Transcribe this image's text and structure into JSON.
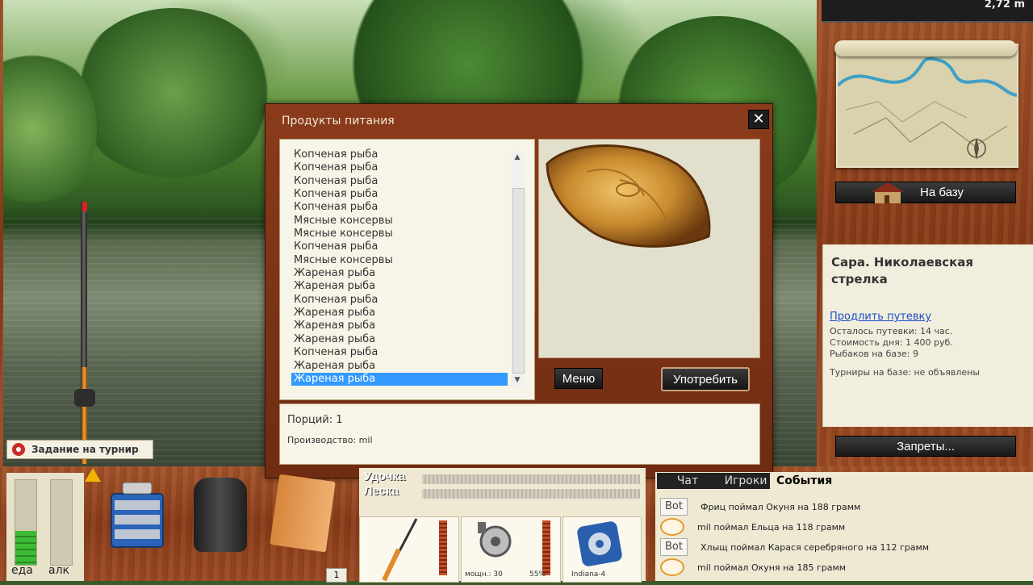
{
  "top_readout": {
    "depth": "2,72 m"
  },
  "right_panel": {
    "to_base_button": "На базу",
    "location": "Сара. Николаевская стрелка",
    "extend_link": "Продлить путевку",
    "info": [
      "Осталось путевки: 14 час.",
      "Стоимость дня: 1 400 руб.",
      "Рыбаков на базе: 9",
      "Турниры на базе: не объявлены"
    ],
    "bans_button": "Запреты..."
  },
  "dialog": {
    "title": "Продукты питания",
    "close_icon": "close-icon",
    "items": [
      "Копченая рыба",
      "Копченая рыба",
      "Копченая рыба",
      "Копченая рыба",
      "Копченая рыба",
      "Мясные консервы",
      "Мясные консервы",
      "Копченая рыба",
      "Мясные консервы",
      "Жареная рыба",
      "Жареная рыба",
      "Копченая рыба",
      "Жареная рыба",
      "Жареная рыба",
      "Жареная рыба",
      "Копченая рыба",
      "Жареная рыба",
      "Жареная рыба"
    ],
    "selected_index": 17,
    "menu_button": "Меню",
    "use_button": "Употребить",
    "portions": "Порций: 1",
    "producer": "Производство: mil"
  },
  "task": {
    "label": "Задание на турнир"
  },
  "meters": {
    "food_label": "еда",
    "alcohol_label": "алк",
    "food_level": 0.4,
    "alcohol_level": 0.0
  },
  "gear": {
    "rod_label": "Удочка",
    "line_label": "Леска",
    "reel_power": "мощн.: 30",
    "reel_percent": "55%",
    "line_name": "Indiana-4",
    "count_badge": "1"
  },
  "events": {
    "tabs": [
      "Чат",
      "Игроки",
      "События"
    ],
    "active_tab": 2,
    "rows": [
      {
        "badge": "Bot",
        "text": "Фриц поймал Окуня на 188 грамм"
      },
      {
        "badge": "",
        "text": "mil поймал Ельца на 118 грамм"
      },
      {
        "badge": "Bot",
        "text": "Хлыщ поймал Карася серебряного на 112 грамм"
      },
      {
        "badge": "",
        "text": "mil поймал Окуня на 185 грамм"
      }
    ]
  },
  "colors": {
    "wood": "#8a3c18",
    "selection": "#3399ff",
    "link": "#1a4fc8"
  }
}
